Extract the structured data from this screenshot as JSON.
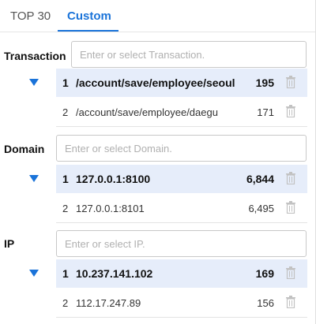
{
  "tabs": [
    {
      "label": "TOP 30",
      "active": false
    },
    {
      "label": "Custom",
      "active": true
    }
  ],
  "accent_color": "#1a73d9",
  "selected_row_color": "#e6edfa",
  "sections": [
    {
      "label": "Transaction",
      "placeholder": "Enter or select Transaction.",
      "rows": [
        {
          "rank": "1",
          "name": "/account/save/employee/seoul",
          "count": "195",
          "selected": true,
          "icon": "trash-icon"
        },
        {
          "rank": "2",
          "name": "/account/save/employee/daegu",
          "count": "171",
          "selected": false,
          "icon": "trash-icon"
        }
      ]
    },
    {
      "label": "Domain",
      "placeholder": "Enter or select Domain.",
      "rows": [
        {
          "rank": "1",
          "name": "127.0.0.1:8100",
          "count": "6,844",
          "selected": true,
          "icon": "trash-icon"
        },
        {
          "rank": "2",
          "name": "127.0.0.1:8101",
          "count": "6,495",
          "selected": false,
          "icon": "trash-icon"
        }
      ]
    },
    {
      "label": "IP",
      "placeholder": "Enter or select IP.",
      "rows": [
        {
          "rank": "1",
          "name": "10.237.141.102",
          "count": "169",
          "selected": true,
          "icon": "trash-icon"
        },
        {
          "rank": "2",
          "name": "112.17.247.89",
          "count": "156",
          "selected": false,
          "icon": "trash-icon"
        }
      ]
    }
  ]
}
